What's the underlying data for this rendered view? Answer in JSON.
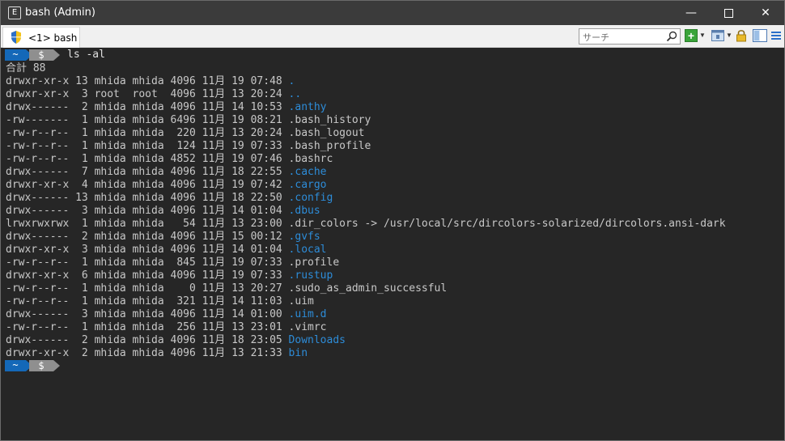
{
  "window": {
    "title": "bash (Admin)",
    "app_icon_glyph": "E",
    "minimize_label": "—",
    "close_label": "✕"
  },
  "tab": {
    "label": "<1> bash"
  },
  "search": {
    "placeholder": "サーチ"
  },
  "toolbar": {
    "plus_label": "+",
    "caret": "▼"
  },
  "terminal": {
    "prompt_home": "~",
    "prompt_symbol": "$",
    "command": "ls -al",
    "total": "合計 88",
    "colors": {
      "dir": "#2d8cd8",
      "text": "#c8c8c8",
      "background": "#262626",
      "prompt_home_bg": "#1468b8",
      "prompt_symbol_bg": "#8f8f8f"
    },
    "entries": [
      {
        "meta": "drwxr-xr-x 13 mhida mhida 4096 11月 19 07:48 ",
        "name": ".",
        "dir": true
      },
      {
        "meta": "drwxr-xr-x  3 root  root  4096 11月 13 20:24 ",
        "name": "..",
        "dir": true
      },
      {
        "meta": "drwx------  2 mhida mhida 4096 11月 14 10:53 ",
        "name": ".anthy",
        "dir": true
      },
      {
        "meta": "-rw-------  1 mhida mhida 6496 11月 19 08:21 ",
        "name": ".bash_history",
        "dir": false
      },
      {
        "meta": "-rw-r--r--  1 mhida mhida  220 11月 13 20:24 ",
        "name": ".bash_logout",
        "dir": false
      },
      {
        "meta": "-rw-r--r--  1 mhida mhida  124 11月 19 07:33 ",
        "name": ".bash_profile",
        "dir": false
      },
      {
        "meta": "-rw-r--r--  1 mhida mhida 4852 11月 19 07:46 ",
        "name": ".bashrc",
        "dir": false
      },
      {
        "meta": "drwx------  7 mhida mhida 4096 11月 18 22:55 ",
        "name": ".cache",
        "dir": true
      },
      {
        "meta": "drwxr-xr-x  4 mhida mhida 4096 11月 19 07:42 ",
        "name": ".cargo",
        "dir": true
      },
      {
        "meta": "drwx------ 13 mhida mhida 4096 11月 18 22:50 ",
        "name": ".config",
        "dir": true
      },
      {
        "meta": "drwx------  3 mhida mhida 4096 11月 14 01:04 ",
        "name": ".dbus",
        "dir": true
      },
      {
        "meta": "lrwxrwxrwx  1 mhida mhida   54 11月 13 23:00 ",
        "name": ".dir_colors -> /usr/local/src/dircolors-solarized/dircolors.ansi-dark",
        "dir": false
      },
      {
        "meta": "drwx------  2 mhida mhida 4096 11月 15 00:12 ",
        "name": ".gvfs",
        "dir": true
      },
      {
        "meta": "drwxr-xr-x  3 mhida mhida 4096 11月 14 01:04 ",
        "name": ".local",
        "dir": true
      },
      {
        "meta": "-rw-r--r--  1 mhida mhida  845 11月 19 07:33 ",
        "name": ".profile",
        "dir": false
      },
      {
        "meta": "drwxr-xr-x  6 mhida mhida 4096 11月 19 07:33 ",
        "name": ".rustup",
        "dir": true
      },
      {
        "meta": "-rw-r--r--  1 mhida mhida    0 11月 13 20:27 ",
        "name": ".sudo_as_admin_successful",
        "dir": false
      },
      {
        "meta": "-rw-r--r--  1 mhida mhida  321 11月 14 11:03 ",
        "name": ".uim",
        "dir": false
      },
      {
        "meta": "drwx------  3 mhida mhida 4096 11月 14 01:00 ",
        "name": ".uim.d",
        "dir": true
      },
      {
        "meta": "-rw-r--r--  1 mhida mhida  256 11月 13 23:01 ",
        "name": ".vimrc",
        "dir": false
      },
      {
        "meta": "drwx------  2 mhida mhida 4096 11月 18 23:05 ",
        "name": "Downloads",
        "dir": true
      },
      {
        "meta": "drwxr-xr-x  2 mhida mhida 4096 11月 13 21:33 ",
        "name": "bin",
        "dir": true
      }
    ]
  }
}
